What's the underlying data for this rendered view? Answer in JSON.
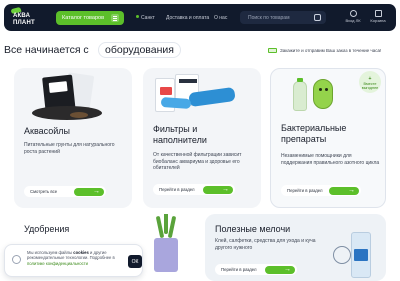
{
  "header": {
    "logo_line1": "АКВА",
    "logo_line2": "ПЛАНТ",
    "catalog_label": "Каталог товаров",
    "city_label": "Санкт",
    "delivery_label": "Доставка и оплата",
    "about_label": "О нас",
    "search_placeholder": "Поиск по товарам",
    "login_label": "Вход ЛК",
    "cart_label": "Корзина"
  },
  "hero": {
    "title": "Все начинается с",
    "title_pill": "оборудования",
    "promo_text": "Закажите и отправим Ваш заказ в течение часа!"
  },
  "cards": [
    {
      "title": "Аквасойлы",
      "description": "Питательные грунты для натурального роста растений",
      "button": "Смотреть все"
    },
    {
      "title": "Фильтры и наполнители",
      "description": "От качественной фильтрации зависит биобаланс аквариума и здоровье его обитателей",
      "button": "Перейти в раздел"
    },
    {
      "title": "Бактериальные препараты",
      "description": "Незаменимые помощники для поддержания правильного азотного цикла",
      "button": "Перейти в раздел",
      "badge_line1": "+",
      "badge_line2": "Вместе выгоднее"
    },
    {
      "title": "Удобрения"
    },
    {
      "title": "Полезные мелочи",
      "description": "Клей, салфетки, средства для ухода и куча другого нужного",
      "button": "Перейти в раздел"
    }
  ],
  "cookie": {
    "text_before": "Мы используем файлы ",
    "text_bold": "cookies",
    "text_after": " и другие рекомендательные технологии. Подробнее в ",
    "link_text": "политике конфиденциальности",
    "ok_label": "ОК"
  },
  "colors": {
    "accent": "#5cbf2a",
    "header_bg": "#111a2c"
  }
}
